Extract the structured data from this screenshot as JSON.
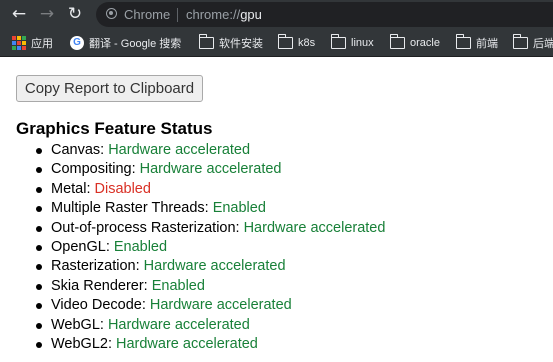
{
  "toolbar": {
    "back_icon": "arrow-left-icon",
    "forward_icon": "arrow-right-icon",
    "reload_icon": "reload-icon",
    "site_chip_label": "Chrome",
    "url_scheme": "chrome://",
    "url_host": "gpu"
  },
  "bookmarks": {
    "items": [
      {
        "label": "应用",
        "icon": "apps-icon"
      },
      {
        "label": "翻译 - Google 搜索",
        "icon": "google-icon"
      },
      {
        "label": "软件安装",
        "icon": "folder-icon"
      },
      {
        "label": "k8s",
        "icon": "folder-icon"
      },
      {
        "label": "linux",
        "icon": "folder-icon"
      },
      {
        "label": "oracle",
        "icon": "folder-icon"
      },
      {
        "label": "前端",
        "icon": "folder-icon"
      },
      {
        "label": "后端",
        "icon": "folder-icon"
      }
    ]
  },
  "page": {
    "copy_button_label": "Copy Report to Clipboard",
    "section_title": "Graphics Feature Status",
    "features": [
      {
        "name": "Canvas:",
        "status": "Hardware accelerated",
        "color": "#188038"
      },
      {
        "name": "Compositing:",
        "status": "Hardware accelerated",
        "color": "#188038"
      },
      {
        "name": "Metal:",
        "status": "Disabled",
        "color": "#d93025"
      },
      {
        "name": "Multiple Raster Threads:",
        "status": "Enabled",
        "color": "#188038"
      },
      {
        "name": "Out-of-process Rasterization:",
        "status": "Hardware accelerated",
        "color": "#188038"
      },
      {
        "name": "OpenGL:",
        "status": "Enabled",
        "color": "#188038"
      },
      {
        "name": "Rasterization:",
        "status": "Hardware accelerated",
        "color": "#188038"
      },
      {
        "name": "Skia Renderer:",
        "status": "Enabled",
        "color": "#188038"
      },
      {
        "name": "Video Decode:",
        "status": "Hardware accelerated",
        "color": "#188038"
      },
      {
        "name": "WebGL:",
        "status": "Hardware accelerated",
        "color": "#188038"
      },
      {
        "name": "WebGL2:",
        "status": "Hardware accelerated",
        "color": "#188038"
      }
    ]
  }
}
